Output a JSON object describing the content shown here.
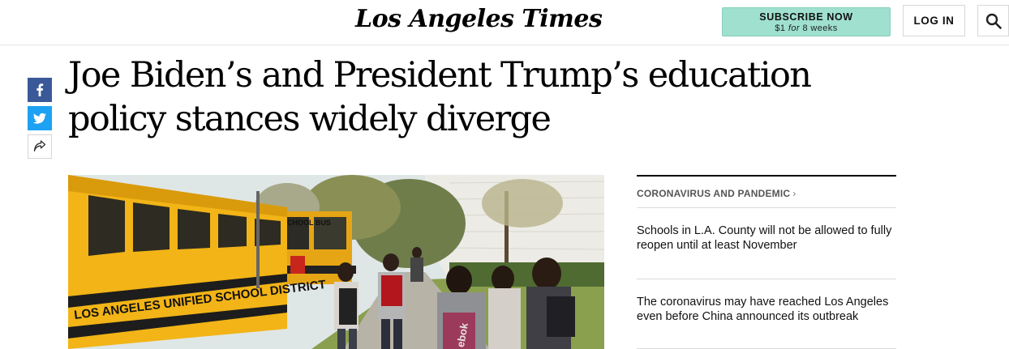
{
  "header": {
    "logo_text": "Los Angeles Times",
    "subscribe_label": "SUBSCRIBE NOW",
    "subscribe_price": "$1",
    "subscribe_for": "for",
    "subscribe_duration": "8 weeks",
    "login_label": "LOG IN",
    "search_icon": "search-icon"
  },
  "share": {
    "facebook_icon": "facebook-icon",
    "twitter_icon": "twitter-icon",
    "more_icon": "share-arrow-icon"
  },
  "article": {
    "headline": "Joe Biden’s and President Trump’s education policy stances widely diverge"
  },
  "related": {
    "section_label": "CORONAVIRUS AND PANDEMIC",
    "section_chevron": "›",
    "stories": [
      {
        "title": "Schools in L.A. County will not be allowed to fully reopen until at least November"
      },
      {
        "title": "The coronavirus may have reached Los Angeles even before China announced its outbreak"
      }
    ]
  },
  "photo": {
    "bus_lettering": "LOS ANGELES UNIFIED SCHOOL DISTRICT",
    "bus_sign": "SCHOOL BUS",
    "backpack_text": "ebok"
  },
  "colors": {
    "subscribe_bg": "#9fe0cf",
    "facebook": "#3b5998",
    "twitter": "#1da1f2",
    "bus_yellow": "#f2b416"
  }
}
